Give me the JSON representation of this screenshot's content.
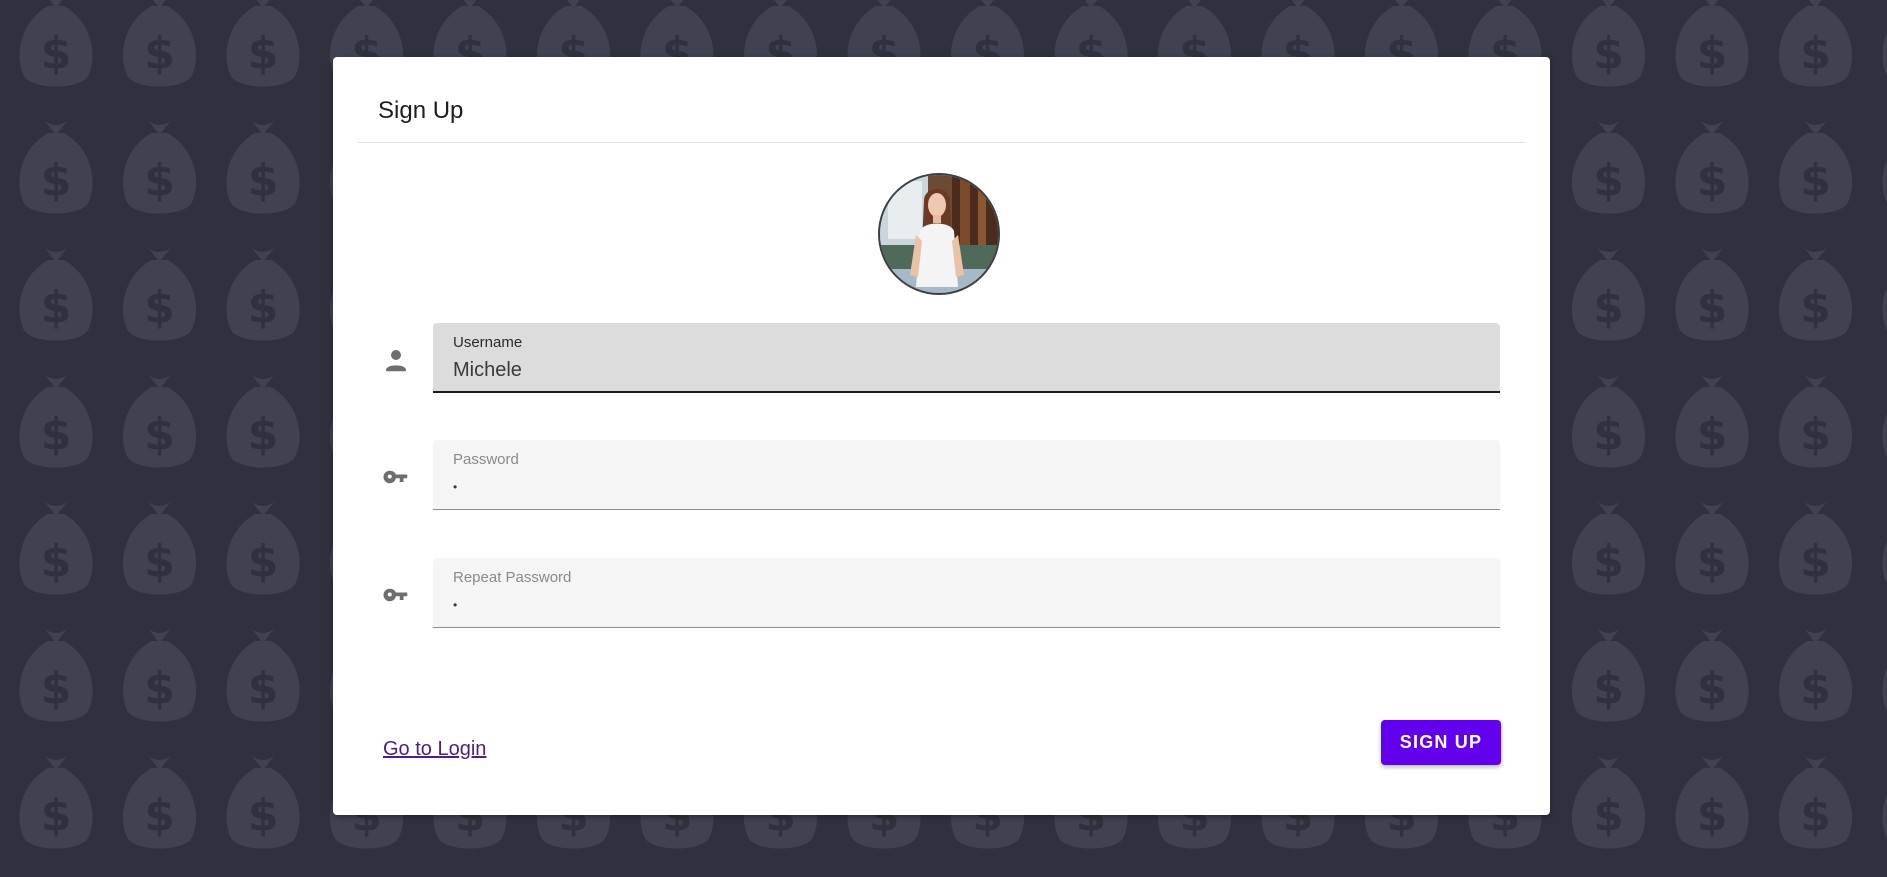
{
  "page": {
    "background_color": "#30313f",
    "pattern_color": "#404252",
    "pattern_icon": "money-bag-icon"
  },
  "card": {
    "title": "Sign Up",
    "avatar_icon": "profile-photo"
  },
  "form": {
    "username": {
      "label": "Username",
      "value": "Michele",
      "icon": "person-icon"
    },
    "password": {
      "label": "Password",
      "value": "•",
      "icon": "key-icon"
    },
    "repeat_password": {
      "label": "Repeat Password",
      "value": "•",
      "icon": "key-icon"
    }
  },
  "actions": {
    "login_link": "Go to Login",
    "signup_button": "SIGN UP",
    "accent_color": "#6200ee"
  }
}
